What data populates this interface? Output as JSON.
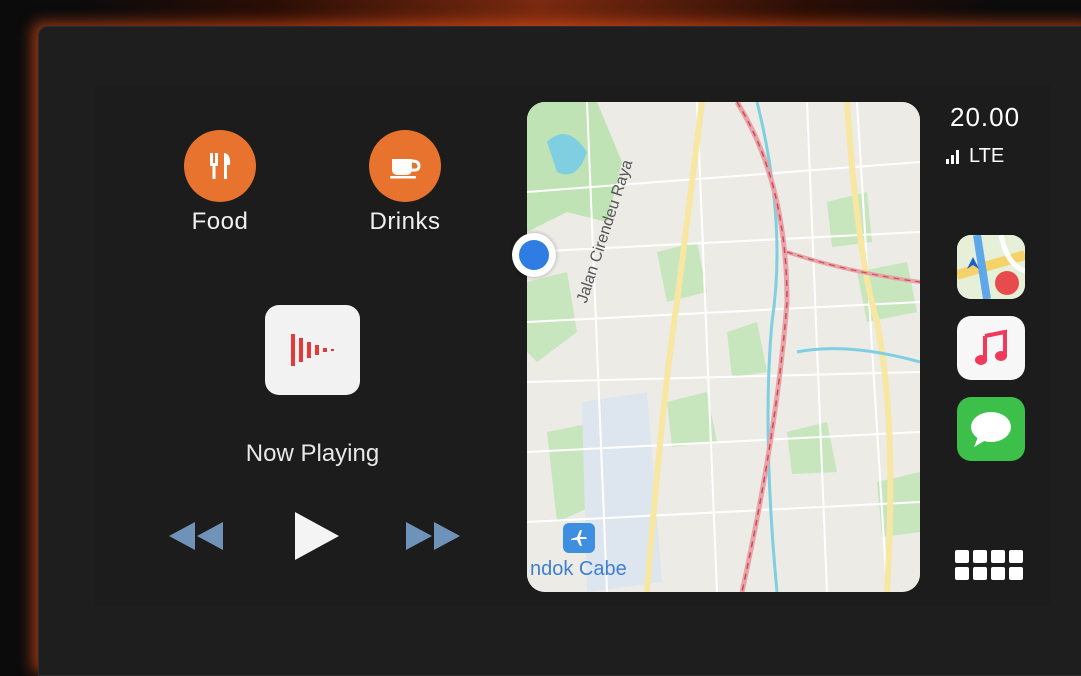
{
  "left_panel": {
    "food": {
      "label": "Food",
      "icon": "fork-knife-icon"
    },
    "drinks": {
      "label": "Drinks",
      "icon": "coffee-cup-icon"
    },
    "now_playing": {
      "label": "Now Playing",
      "icon": "podcast-bars-icon"
    },
    "controls": {
      "rewind": "rewind-icon",
      "play": "play-icon",
      "fast_forward": "fast-forward-icon"
    }
  },
  "map": {
    "street_name": "Jalan Cirendeu Raya",
    "poi_name": "ndok Cabe",
    "poi_sub": "Airport"
  },
  "status": {
    "time": "20.00",
    "network": "LTE"
  },
  "dock": {
    "apps": [
      "maps-icon",
      "music-icon",
      "messages-icon"
    ],
    "launcher": "app-grid-icon"
  },
  "colors": {
    "accent_orange": "#e8732e",
    "map_blue": "#3f7fcf",
    "messages_green": "#3cc04a"
  }
}
